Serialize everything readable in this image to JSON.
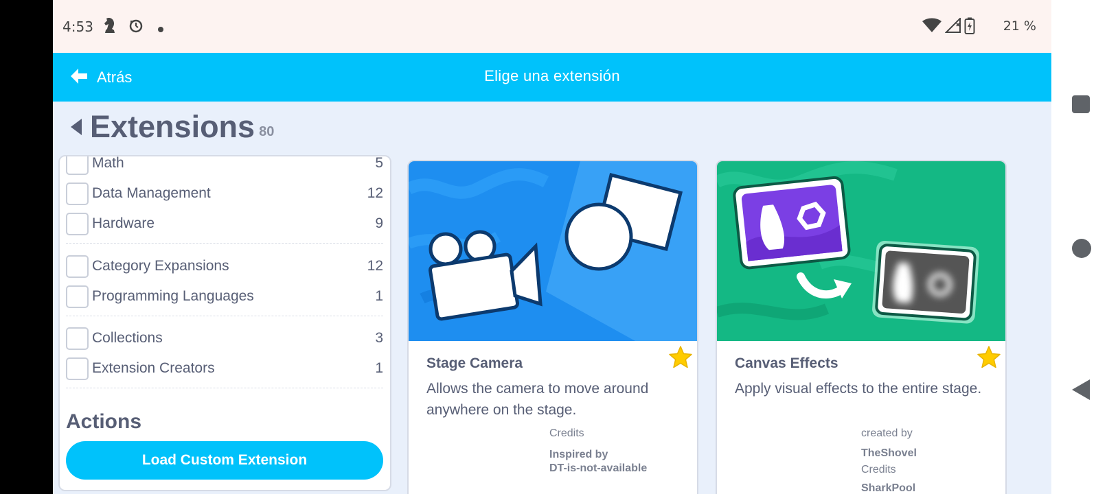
{
  "status_bar": {
    "time": "4:53",
    "battery": "21 %",
    "icons": [
      "chess-knight-icon",
      "sync-icon",
      "dot-icon",
      "wifi-icon",
      "no-signal-icon",
      "battery-charging-icon"
    ]
  },
  "app_bar": {
    "back_label": "Atrás",
    "title": "Elige una extensión"
  },
  "extensions": {
    "heading": "Extensions",
    "count": "80"
  },
  "sidebar": {
    "categories": [
      {
        "label": "Math",
        "count": "5"
      },
      {
        "label": "Data Management",
        "count": "12"
      },
      {
        "label": "Hardware",
        "count": "9"
      },
      {
        "label": "Category Expansions",
        "count": "12"
      },
      {
        "label": "Programming Languages",
        "count": "1"
      },
      {
        "label": "Collections",
        "count": "3"
      },
      {
        "label": "Extension Creators",
        "count": "1"
      }
    ],
    "actions_title": "Actions",
    "load_button": "Load Custom Extension"
  },
  "cards": [
    {
      "name": "Stage Camera",
      "description": "Allows the camera to move around anywhere on the stage.",
      "credits_label": "Credits",
      "credits_value_1": "Inspired by",
      "credits_value_2": "DT-is-not-available",
      "accent": "#1e8ef0"
    },
    {
      "name": "Canvas Effects",
      "description": "Apply visual effects to the entire stage.",
      "created_label": "created by",
      "created_value": "TheShovel",
      "credits_label": "Credits",
      "credits_value": "SharkPool",
      "accent": "#14b884"
    }
  ],
  "colors": {
    "header": "#00c2fb",
    "text": "#575e75",
    "star": "#ffcc00"
  }
}
